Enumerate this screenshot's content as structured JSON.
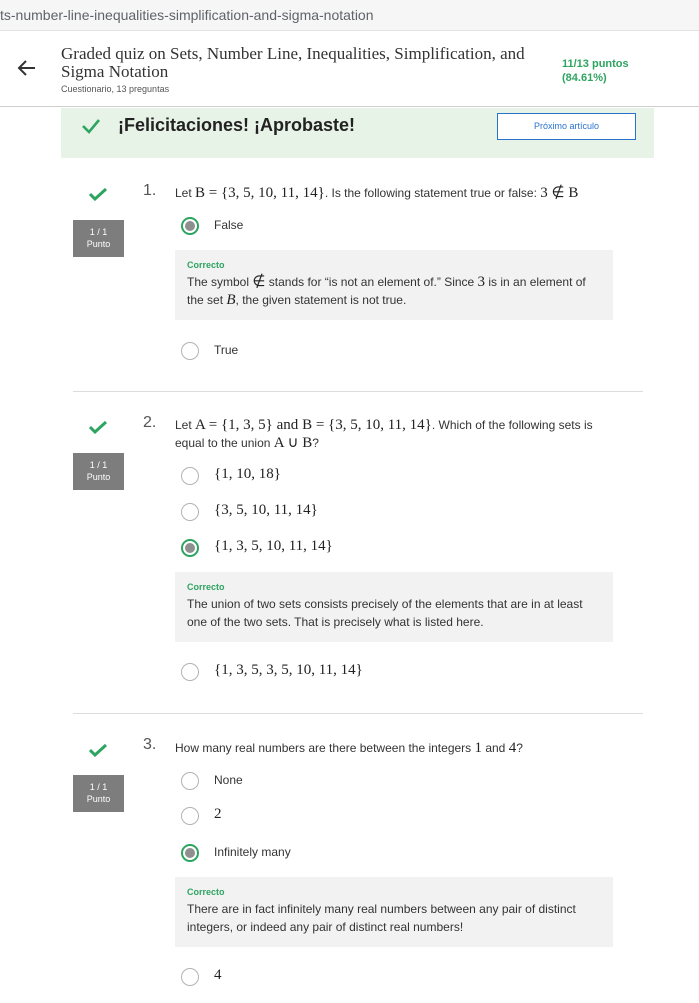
{
  "browser": {
    "url": "ts-number-line-inequalities-simplification-and-sigma-notation"
  },
  "header": {
    "title": "Graded quiz on Sets, Number Line, Inequalities, Simplification, and Sigma Notation",
    "subtitle": "Cuestionario, 13 preguntas",
    "score_line1": "11/13 puntos",
    "score_line2": "(84.61%)"
  },
  "banner": {
    "text": "¡Felicitaciones! ¡Aprobaste!",
    "next_button": "Próximo artículo"
  },
  "colors": {
    "accent_green": "#2ea461",
    "link_blue": "#2a73cc",
    "badge_gray": "#7d7d7d"
  },
  "questions": [
    {
      "number": "1.",
      "badge_score": "1 / 1",
      "badge_label": "Punto",
      "prompt_pre": "Let ",
      "prompt_math1": "B = {3, 5, 10, 11, 14}",
      "prompt_mid": ". Is the following statement true or false: ",
      "prompt_math2": "3 ∉ B",
      "options": [
        {
          "label": "False",
          "selected": true
        },
        {
          "label": "True",
          "selected": false
        }
      ],
      "feedback": {
        "title": "Correcto",
        "t1": "The symbol ",
        "m1": "∉",
        "t2": " stands for “is not an element of.” Since ",
        "m2": "3",
        "t3": " is in an element of the set ",
        "m3": "B",
        "t4": ", the given statement is not true."
      }
    },
    {
      "number": "2.",
      "badge_score": "1 / 1",
      "badge_label": "Punto",
      "prompt_pre": "Let ",
      "prompt_math1": "A = {1, 3, 5}",
      "prompt_and": " and ",
      "prompt_math2": "B = {3, 5, 10, 11, 14}",
      "prompt_mid": ". Which of the following sets is equal to the union ",
      "prompt_math3": "A ∪ B",
      "prompt_end": "?",
      "options": [
        {
          "label": "{1, 10, 18}",
          "selected": false
        },
        {
          "label": "{3, 5, 10, 11, 14}",
          "selected": false
        },
        {
          "label": "{1, 3, 5, 10, 11, 14}",
          "selected": true
        },
        {
          "label": "{1, 3, 5, 3, 5, 10, 11, 14}",
          "selected": false
        }
      ],
      "feedback": {
        "title": "Correcto",
        "text": "The union of two sets consists precisely of the elements that are in at least one of the two sets. That is precisely what is listed here."
      }
    },
    {
      "number": "3.",
      "badge_score": "1 / 1",
      "badge_label": "Punto",
      "prompt_pre": "How many real numbers are there between the integers ",
      "prompt_math1": "1",
      "prompt_and": " and ",
      "prompt_math2": "4",
      "prompt_end": "?",
      "options": [
        {
          "label": "None",
          "selected": false
        },
        {
          "label": "2",
          "selected": false
        },
        {
          "label": "Infinitely many",
          "selected": true
        },
        {
          "label": "4",
          "selected": false
        }
      ],
      "feedback": {
        "title": "Correcto",
        "text": "There are in fact infinitely many real numbers between any pair of distinct integers, or indeed any pair of distinct real numbers!"
      }
    }
  ]
}
